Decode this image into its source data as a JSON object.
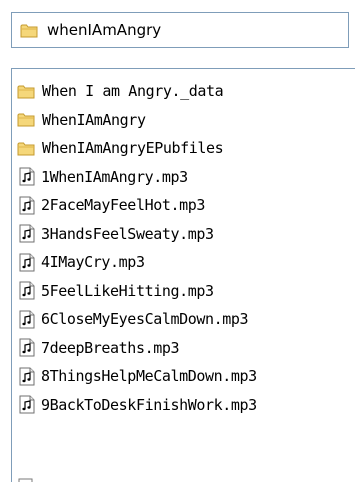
{
  "address": {
    "path": "whenIAmAngry",
    "icon": "folder-icon"
  },
  "files": [
    {
      "name": "When I am Angry._data",
      "type": "folder"
    },
    {
      "name": "WhenIAmAngry",
      "type": "folder"
    },
    {
      "name": "WhenIAmAngryEPubfiles",
      "type": "folder"
    },
    {
      "name": "1WhenIAmAngry.mp3",
      "type": "audio"
    },
    {
      "name": "2FaceMayFeelHot.mp3",
      "type": "audio"
    },
    {
      "name": "3HandsFeelSweaty.mp3",
      "type": "audio"
    },
    {
      "name": "4IMayCry.mp3",
      "type": "audio"
    },
    {
      "name": "5FeelLikeHitting.mp3",
      "type": "audio"
    },
    {
      "name": "6CloseMyEyesCalmDown.mp3",
      "type": "audio"
    },
    {
      "name": "7deepBreaths.mp3",
      "type": "audio"
    },
    {
      "name": "8ThingsHelpMeCalmDown.mp3",
      "type": "audio"
    },
    {
      "name": "9BackToDeskFinishWork.mp3",
      "type": "audio"
    }
  ],
  "colors": {
    "folder_fill": "#f5d77a",
    "folder_edge": "#c49a2c",
    "border": "#7f9db9"
  }
}
